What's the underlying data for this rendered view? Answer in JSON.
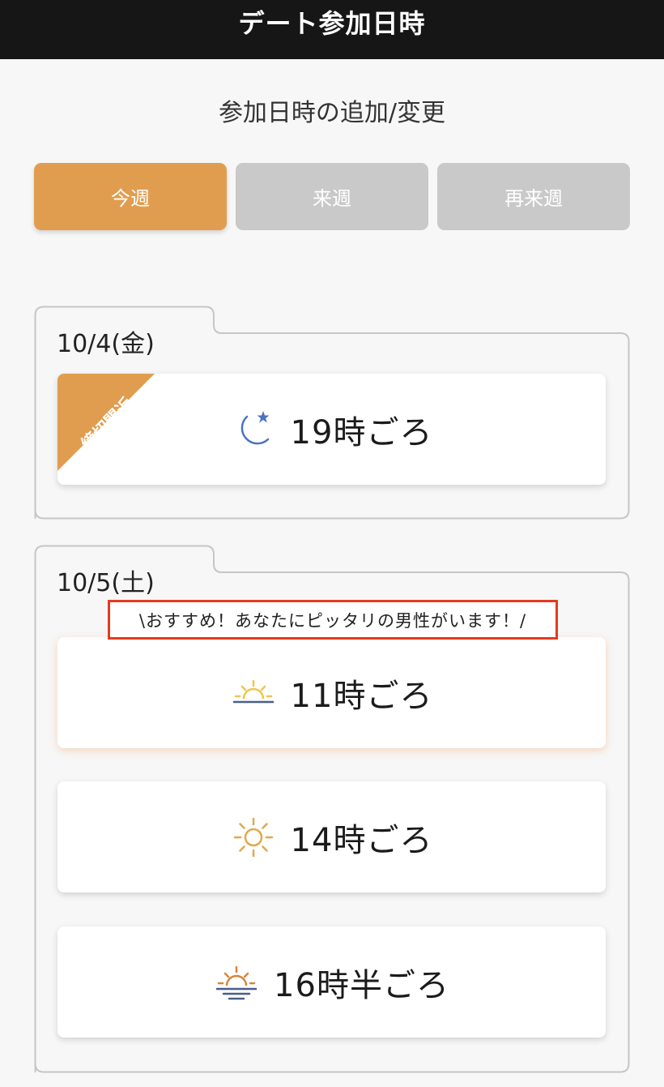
{
  "header": {
    "title": "デート参加日時"
  },
  "subtitle": "参加日時の追加/変更",
  "week_tabs": [
    {
      "label": "今週",
      "active": true
    },
    {
      "label": "来週",
      "active": false
    },
    {
      "label": "再来週",
      "active": false
    }
  ],
  "days": [
    {
      "label": "10/4(金)",
      "slots": [
        {
          "time": "19時ごろ",
          "icon": "moon-star-icon",
          "badge": "締切間近"
        }
      ]
    },
    {
      "label": "10/5(土)",
      "recommendation": "\\おすすめ！あなたにピッタリの男性がいます！/",
      "slots": [
        {
          "time": "11時ごろ",
          "icon": "sunrise-icon"
        },
        {
          "time": "14時ごろ",
          "icon": "sun-icon"
        },
        {
          "time": "16時半ごろ",
          "icon": "sunset-icon"
        }
      ]
    }
  ],
  "colors": {
    "header_bg": "#161616",
    "accent": "#e19d4f",
    "inactive_tab": "#c9c9c9",
    "moon": "#4a72c4",
    "sun_light": "#f0c64a",
    "sun": "#e0a94a",
    "sunset": "#d9843a",
    "banner_border": "#e63a1f"
  }
}
